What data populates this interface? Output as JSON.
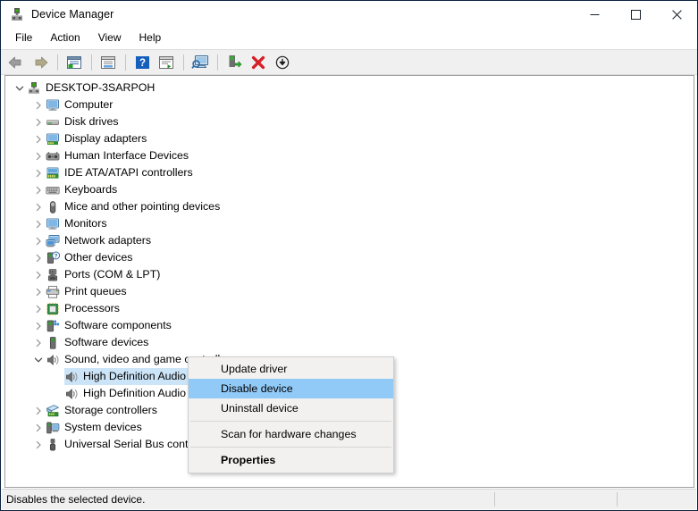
{
  "window": {
    "title": "Device Manager",
    "icon": "device-manager-icon",
    "controls": {
      "minimize": "—",
      "maximize": "□",
      "close": "✕"
    }
  },
  "menubar": {
    "items": [
      {
        "label": "File"
      },
      {
        "label": "Action"
      },
      {
        "label": "View"
      },
      {
        "label": "Help"
      }
    ]
  },
  "toolbar": {
    "buttons": [
      {
        "name": "back-icon"
      },
      {
        "name": "forward-icon"
      },
      {
        "name": "separator"
      },
      {
        "name": "show-hide-console-tree-icon"
      },
      {
        "name": "separator"
      },
      {
        "name": "properties-icon"
      },
      {
        "name": "separator"
      },
      {
        "name": "help-icon"
      },
      {
        "name": "update-driver-icon"
      },
      {
        "name": "separator"
      },
      {
        "name": "scan-for-hardware-changes-icon"
      },
      {
        "name": "separator"
      },
      {
        "name": "enable-device-icon"
      },
      {
        "name": "uninstall-device-icon"
      },
      {
        "name": "disable-device-icon"
      }
    ]
  },
  "tree": {
    "nodes": [
      {
        "label": "DESKTOP-3SARPOH",
        "indent": 0,
        "twisty": "expanded",
        "icon": "computer-root-icon",
        "selected": false
      },
      {
        "label": "Computer",
        "indent": 1,
        "twisty": "collapsed",
        "icon": "monitor-icon",
        "selected": false
      },
      {
        "label": "Disk drives",
        "indent": 1,
        "twisty": "collapsed",
        "icon": "disk-drive-icon",
        "selected": false
      },
      {
        "label": "Display adapters",
        "indent": 1,
        "twisty": "collapsed",
        "icon": "display-adapter-icon",
        "selected": false
      },
      {
        "label": "Human Interface Devices",
        "indent": 1,
        "twisty": "collapsed",
        "icon": "hid-icon",
        "selected": false
      },
      {
        "label": "IDE ATA/ATAPI controllers",
        "indent": 1,
        "twisty": "collapsed",
        "icon": "ide-controller-icon",
        "selected": false
      },
      {
        "label": "Keyboards",
        "indent": 1,
        "twisty": "collapsed",
        "icon": "keyboard-icon",
        "selected": false
      },
      {
        "label": "Mice and other pointing devices",
        "indent": 1,
        "twisty": "collapsed",
        "icon": "mouse-icon",
        "selected": false
      },
      {
        "label": "Monitors",
        "indent": 1,
        "twisty": "collapsed",
        "icon": "monitor-icon",
        "selected": false
      },
      {
        "label": "Network adapters",
        "indent": 1,
        "twisty": "collapsed",
        "icon": "network-adapter-icon",
        "selected": false
      },
      {
        "label": "Other devices",
        "indent": 1,
        "twisty": "collapsed",
        "icon": "other-device-icon",
        "selected": false
      },
      {
        "label": "Ports (COM & LPT)",
        "indent": 1,
        "twisty": "collapsed",
        "icon": "port-icon",
        "selected": false
      },
      {
        "label": "Print queues",
        "indent": 1,
        "twisty": "collapsed",
        "icon": "printer-icon",
        "selected": false
      },
      {
        "label": "Processors",
        "indent": 1,
        "twisty": "collapsed",
        "icon": "processor-icon",
        "selected": false
      },
      {
        "label": "Software components",
        "indent": 1,
        "twisty": "collapsed",
        "icon": "software-component-icon",
        "selected": false
      },
      {
        "label": "Software devices",
        "indent": 1,
        "twisty": "collapsed",
        "icon": "software-device-icon",
        "selected": false
      },
      {
        "label": "Sound, video and game controllers",
        "indent": 1,
        "twisty": "expanded",
        "icon": "speaker-icon",
        "selected": false
      },
      {
        "label": "High Definition Audio Device",
        "indent": 2,
        "twisty": "none",
        "icon": "speaker-icon",
        "selected": true
      },
      {
        "label": "High Definition Audio Device",
        "indent": 2,
        "twisty": "none",
        "icon": "speaker-icon",
        "selected": false
      },
      {
        "label": "Storage controllers",
        "indent": 1,
        "twisty": "collapsed",
        "icon": "storage-controller-icon",
        "selected": false
      },
      {
        "label": "System devices",
        "indent": 1,
        "twisty": "collapsed",
        "icon": "system-device-icon",
        "selected": false
      },
      {
        "label": "Universal Serial Bus controllers",
        "indent": 1,
        "twisty": "collapsed",
        "icon": "usb-icon",
        "selected": false
      }
    ]
  },
  "context_menu": {
    "items": [
      {
        "label": "Update driver",
        "type": "item",
        "highlight": false,
        "bold": false
      },
      {
        "label": "Disable device",
        "type": "item",
        "highlight": true,
        "bold": false
      },
      {
        "label": "Uninstall device",
        "type": "item",
        "highlight": false,
        "bold": false
      },
      {
        "type": "separator"
      },
      {
        "label": "Scan for hardware changes",
        "type": "item",
        "highlight": false,
        "bold": false
      },
      {
        "type": "separator"
      },
      {
        "label": "Properties",
        "type": "item",
        "highlight": false,
        "bold": true
      }
    ]
  },
  "statusbar": {
    "text": "Disables the selected device."
  },
  "colors": {
    "selection": "#cce4f7",
    "menu_highlight": "#91c9f7",
    "toolbar_bg": "#f0f0f0",
    "window_border": "#0a2240",
    "status_bg": "#f0f0f0"
  }
}
